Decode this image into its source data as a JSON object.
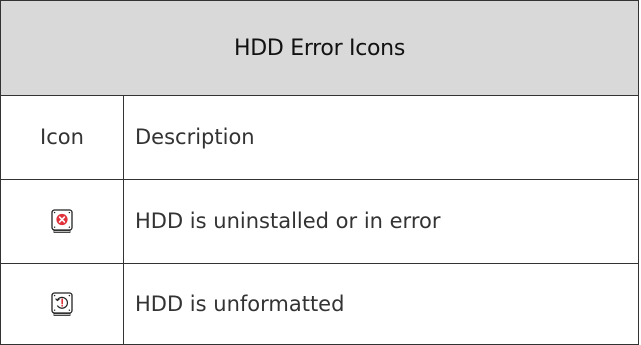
{
  "table": {
    "title": "HDD Error Icons",
    "columns": [
      "Icon",
      "Description"
    ],
    "rows": [
      {
        "icon": "hdd-error-icon",
        "description": "HDD is uninstalled or in error"
      },
      {
        "icon": "hdd-unformatted-icon",
        "description": "HDD is unformatted"
      }
    ]
  },
  "colors": {
    "header_bg": "#d9d9d9",
    "border": "#333333",
    "error_red": "#e0303a"
  }
}
